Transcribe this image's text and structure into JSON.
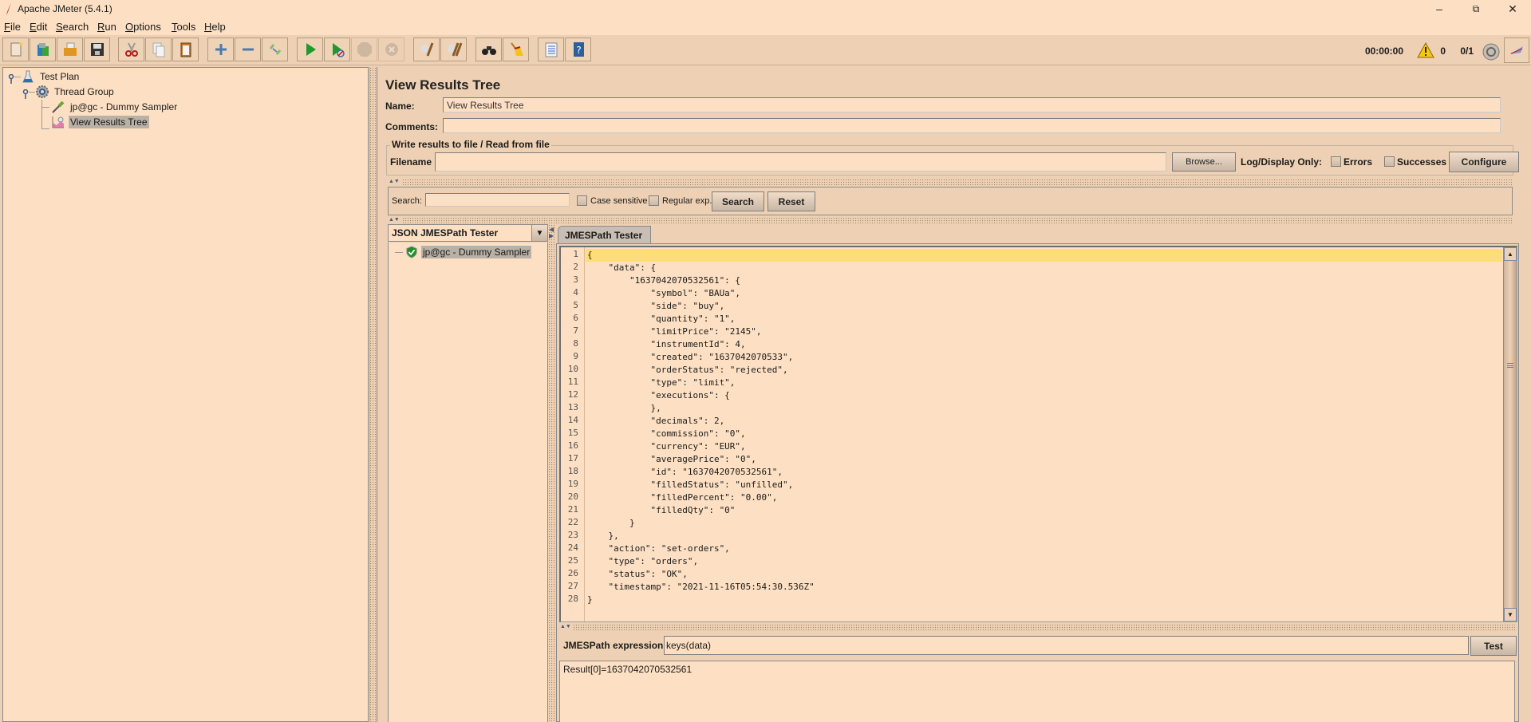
{
  "window": {
    "title": "Apache JMeter (5.4.1)",
    "controls": [
      "minimize",
      "restore",
      "close"
    ]
  },
  "menu": [
    {
      "label": "File",
      "mnemonic": "F",
      "rest": "ile"
    },
    {
      "label": "Edit",
      "mnemonic": "E",
      "rest": "dit"
    },
    {
      "label": "Search",
      "mnemonic": "S",
      "rest": "earch"
    },
    {
      "label": "Run",
      "mnemonic": "R",
      "rest": "un"
    },
    {
      "label": "Options",
      "mnemonic": "O",
      "rest": "ptions"
    },
    {
      "label": "Tools",
      "mnemonic": "T",
      "rest": "ools"
    },
    {
      "label": "Help",
      "mnemonic": "H",
      "rest": "elp"
    }
  ],
  "toolbar": {
    "buttons": [
      {
        "name": "new",
        "icon": "new-document-icon",
        "enabled": true
      },
      {
        "name": "templates",
        "icon": "templates-icon",
        "enabled": true
      },
      {
        "name": "open",
        "icon": "open-folder-icon",
        "enabled": true
      },
      {
        "name": "save",
        "icon": "save-disk-icon",
        "enabled": true
      },
      {
        "name": "cut",
        "icon": "scissors-icon",
        "enabled": true
      },
      {
        "name": "copy",
        "icon": "copy-icon",
        "enabled": true
      },
      {
        "name": "paste",
        "icon": "paste-clipboard-icon",
        "enabled": true
      },
      {
        "name": "expand-all",
        "icon": "plus-icon",
        "enabled": true
      },
      {
        "name": "collapse-all",
        "icon": "minus-icon",
        "enabled": true
      },
      {
        "name": "toggle",
        "icon": "toggle-icon",
        "enabled": true
      },
      {
        "name": "start",
        "icon": "play-icon",
        "enabled": true
      },
      {
        "name": "start-no-pauses",
        "icon": "play-no-timers-icon",
        "enabled": true
      },
      {
        "name": "stop",
        "icon": "stop-icon",
        "enabled": false
      },
      {
        "name": "shutdown",
        "icon": "shutdown-icon",
        "enabled": false
      },
      {
        "name": "clear",
        "icon": "clear-broom-icon",
        "enabled": true
      },
      {
        "name": "clear-all",
        "icon": "clear-all-broom-icon",
        "enabled": true
      },
      {
        "name": "search",
        "icon": "binoculars-icon",
        "enabled": true
      },
      {
        "name": "reset-search",
        "icon": "broom-icon",
        "enabled": true
      },
      {
        "name": "function-helper",
        "icon": "function-list-icon",
        "enabled": true
      },
      {
        "name": "help",
        "icon": "help-book-icon",
        "enabled": true
      }
    ],
    "timer": "00:00:00",
    "warning_count": "0",
    "threads": "0/1"
  },
  "tree": {
    "nodes": [
      {
        "label": "Test Plan",
        "icon": "flask-icon",
        "level": 0,
        "selected": false
      },
      {
        "label": "Thread Group",
        "icon": "gear-icon",
        "level": 1,
        "selected": false
      },
      {
        "label": "jp@gc - Dummy Sampler",
        "icon": "pipette-icon",
        "level": 2,
        "selected": false
      },
      {
        "label": "View Results Tree",
        "icon": "graph-icon",
        "level": 2,
        "selected": true
      }
    ]
  },
  "panel": {
    "title": "View Results Tree",
    "name_label": "Name:",
    "name_value": "View Results Tree",
    "comments_label": "Comments:",
    "comments_value": "",
    "file_section_title": "Write results to file / Read from file",
    "filename_label": "Filename",
    "filename_value": "",
    "browse_label": "Browse...",
    "log_display_label": "Log/Display Only:",
    "errors_label": "Errors",
    "errors_checked": false,
    "successes_label": "Successes",
    "successes_checked": false,
    "configure_label": "Configure"
  },
  "search": {
    "label": "Search:",
    "value": "",
    "case_sensitive_label": "Case sensitive",
    "case_sensitive_checked": false,
    "regex_label": "Regular exp.",
    "regex_checked": false,
    "search_button": "Search",
    "reset_button": "Reset"
  },
  "results": {
    "renderer": "JSON JMESPath Tester",
    "samples": [
      {
        "label": "jp@gc - Dummy Sampler",
        "status": "success",
        "icon": "success-shield-icon"
      }
    ],
    "tab_label": "JMESPath Tester",
    "response_lines": [
      "{",
      "    \"data\": {",
      "        \"1637042070532561\": {",
      "            \"symbol\": \"BAUa\",",
      "            \"side\": \"buy\",",
      "            \"quantity\": \"1\",",
      "            \"limitPrice\": \"2145\",",
      "            \"instrumentId\": 4,",
      "            \"created\": \"1637042070533\",",
      "            \"orderStatus\": \"rejected\",",
      "            \"type\": \"limit\",",
      "            \"executions\": {",
      "            },",
      "            \"decimals\": 2,",
      "            \"commission\": \"0\",",
      "            \"currency\": \"EUR\",",
      "            \"averagePrice\": \"0\",",
      "            \"id\": \"1637042070532561\",",
      "            \"filledStatus\": \"unfilled\",",
      "            \"filledPercent\": \"0.00\",",
      "            \"filledQty\": \"0\"",
      "        }",
      "    },",
      "    \"action\": \"set-orders\",",
      "    \"type\": \"orders\",",
      "    \"status\": \"OK\",",
      "    \"timestamp\": \"2021-11-16T05:54:30.536Z\"",
      "}"
    ],
    "current_line": 1,
    "expression_label": "JMESPath expression",
    "expression_value": "keys(data)",
    "test_button": "Test",
    "result_text": "Result[0]=1637042070532561"
  },
  "colors": {
    "background": "#eed1b4",
    "field_background": "#fde0c3",
    "current_line_highlight": "#fddc7a",
    "selection": "#b9b0a6"
  }
}
